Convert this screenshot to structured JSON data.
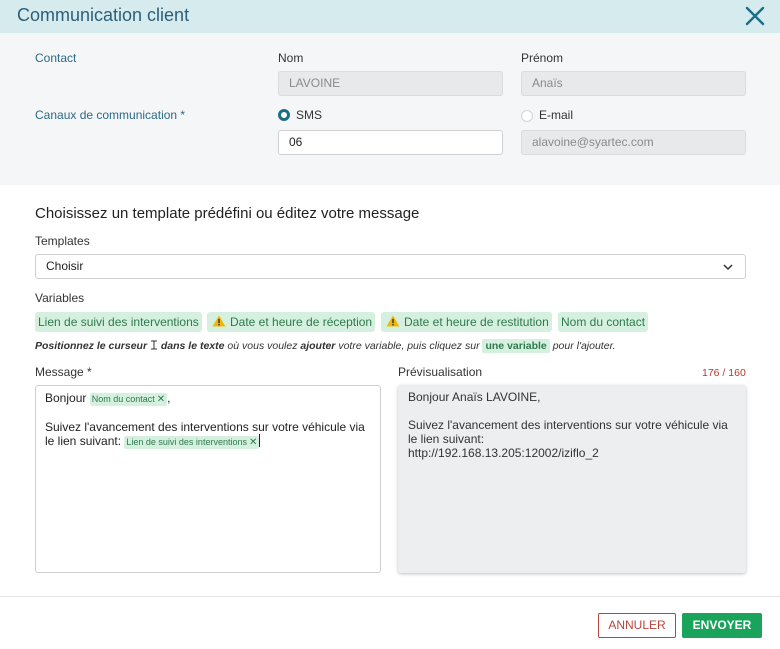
{
  "header": {
    "title": "Communication client"
  },
  "contact": {
    "label": "Contact",
    "nom_label": "Nom",
    "nom_value": "LAVOINE",
    "prenom_label": "Prénom",
    "prenom_value": "Anaïs"
  },
  "channels": {
    "label": "Canaux de communication *",
    "sms_label": "SMS",
    "sms_value": "06",
    "email_label": "E-mail",
    "email_value": "alavoine@syartec.com",
    "selected": "SMS"
  },
  "section_title": "Choisissez un template prédéfini ou éditez votre message",
  "templates": {
    "label": "Templates",
    "selected": "Choisir"
  },
  "variables": {
    "label": "Variables",
    "items": [
      {
        "label": "Lien de suivi des interventions",
        "warning": false
      },
      {
        "label": "Date et heure de réception",
        "warning": true
      },
      {
        "label": "Date et heure de restitution",
        "warning": true
      },
      {
        "label": "Nom du contact",
        "warning": false
      }
    ],
    "hint": {
      "part1": "Positionnez le curseur",
      "part2": "dans le texte",
      "part3": "où vous voulez",
      "part4": "ajouter",
      "part5": "votre variable, puis cliquez sur",
      "chip": "une variable",
      "part6": "pour l'ajouter."
    }
  },
  "message": {
    "label": "Message *",
    "greeting": "Bonjour",
    "tag_contact": "Nom du contact",
    "comma": ",",
    "line2": "Suivez l'avancement des interventions sur votre véhicule via le lien suivant:",
    "tag_link": "Lien de suivi des interventions"
  },
  "preview": {
    "label": "Prévisualisation",
    "counter": "176 / 160",
    "line1": "Bonjour Anaïs LAVOINE,",
    "line2": "Suivez l'avancement des interventions sur votre véhicule via le lien suivant:",
    "line3": "http://192.168.13.205:12002/iziflo_2"
  },
  "buttons": {
    "cancel": "ANNULER",
    "send": "ENVOYER"
  },
  "colors": {
    "header_bg": "#d6ebee",
    "title": "#2b5f7a",
    "chip_bg": "#d5f0df",
    "chip_text": "#2f7a4d",
    "cancel": "#b8453c",
    "send": "#1aa35b",
    "counter": "#b03a2e"
  }
}
